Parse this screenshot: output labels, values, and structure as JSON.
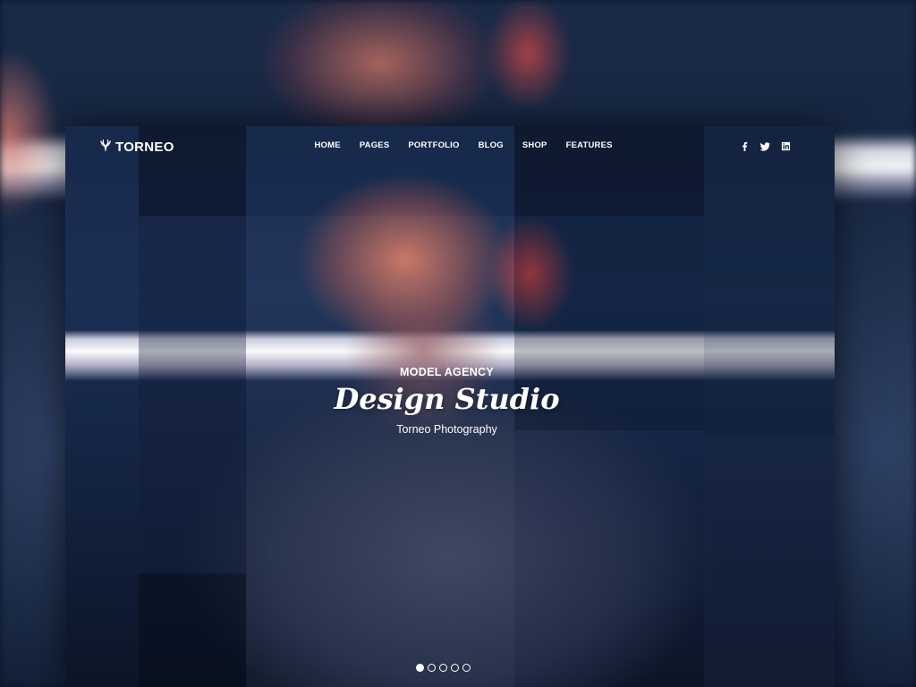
{
  "brand": {
    "name": "TORNEO",
    "logo_icon": "deer-antlers-icon"
  },
  "nav": {
    "items": [
      {
        "label": "HOME"
      },
      {
        "label": "PAGES"
      },
      {
        "label": "PORTFOLIO"
      },
      {
        "label": "BLOG"
      },
      {
        "label": "SHOP"
      },
      {
        "label": "FEATURES"
      }
    ]
  },
  "social": [
    {
      "icon": "facebook-icon"
    },
    {
      "icon": "twitter-icon"
    },
    {
      "icon": "linkedin-icon"
    }
  ],
  "hero": {
    "kicker": "MODEL AGENCY",
    "headline": "Design Studio",
    "subline": "Torneo Photography"
  },
  "slider": {
    "total": 5,
    "active": 1
  },
  "colors": {
    "text": "#ffffff",
    "background": "#0b1426"
  }
}
